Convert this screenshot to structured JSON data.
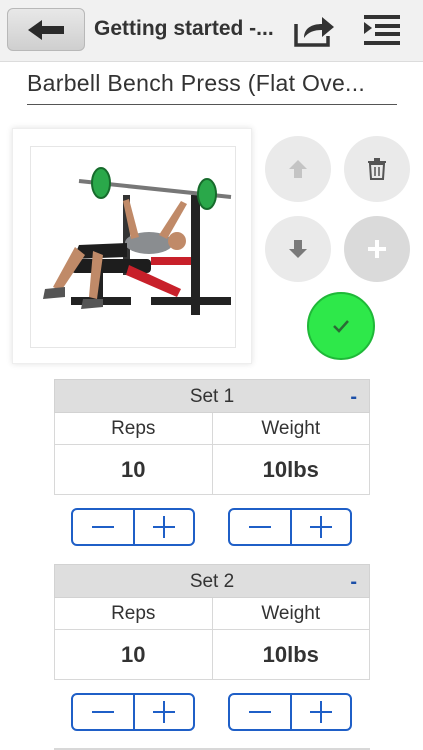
{
  "header": {
    "title": "Getting started -...",
    "icons": {
      "back": "arrow-left-icon",
      "share": "share-icon",
      "menu": "menu-icon"
    }
  },
  "exercise": {
    "name": "Barbell Bench Press (Flat Ove..."
  },
  "actions": {
    "icons": [
      "arrow-up-icon",
      "trash-icon",
      "arrow-down-icon",
      "plus-icon",
      "check-icon"
    ],
    "accent_color": "#2ee84a"
  },
  "sets": [
    {
      "title": "Set 1",
      "remove_label": "-",
      "reps_label": "Reps",
      "weight_label": "Weight",
      "reps": "10",
      "weight": "10lbs"
    },
    {
      "title": "Set 2",
      "remove_label": "-",
      "reps_label": "Reps",
      "weight_label": "Weight",
      "reps": "10",
      "weight": "10lbs"
    }
  ],
  "stepper": {
    "minus": "−",
    "plus": "+",
    "color": "#1f5fc7"
  }
}
